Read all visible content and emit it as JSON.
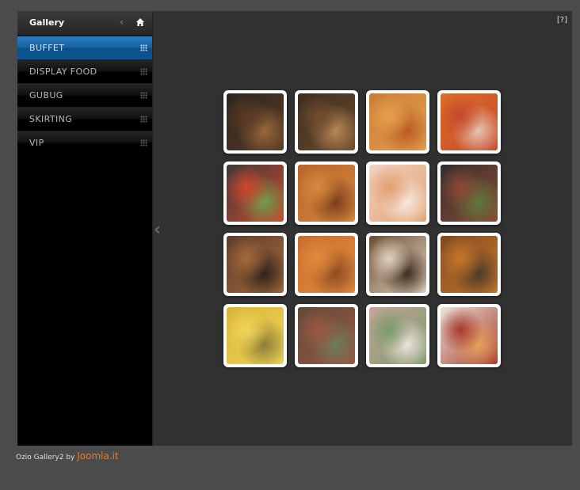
{
  "sidebar": {
    "title": "Gallery",
    "items": [
      {
        "label": "BUFFET",
        "active": true
      },
      {
        "label": "DISPLAY FOOD",
        "active": false
      },
      {
        "label": "GUBUG",
        "active": false
      },
      {
        "label": "SKIRTING",
        "active": false
      },
      {
        "label": "VIP",
        "active": false
      }
    ]
  },
  "help_label": "[?]",
  "thumbnails": [
    {
      "name": "thumb-1",
      "colors": [
        "#2a2520",
        "#5a3a24",
        "#9b6a3c"
      ]
    },
    {
      "name": "thumb-2",
      "colors": [
        "#3a2b20",
        "#6f4b2c",
        "#b98a5a"
      ]
    },
    {
      "name": "thumb-3",
      "colors": [
        "#c87b35",
        "#e6a14e",
        "#b85a22"
      ]
    },
    {
      "name": "thumb-4",
      "colors": [
        "#d96f2a",
        "#c6492a",
        "#e7c7b8"
      ]
    },
    {
      "name": "thumb-5",
      "colors": [
        "#3a3a3a",
        "#d0462e",
        "#6f9f4a"
      ]
    },
    {
      "name": "thumb-6",
      "colors": [
        "#b9622b",
        "#d48a3e",
        "#7a3d1c"
      ]
    },
    {
      "name": "thumb-7",
      "colors": [
        "#f1d4c6",
        "#e3a06f",
        "#f6e9e2"
      ]
    },
    {
      "name": "thumb-8",
      "colors": [
        "#2e2e2e",
        "#8e4a34",
        "#5f7a3a"
      ]
    },
    {
      "name": "thumb-9",
      "colors": [
        "#5d3b2c",
        "#a46a3a",
        "#2e211b"
      ]
    },
    {
      "name": "thumb-10",
      "colors": [
        "#c76d2e",
        "#e28a3c",
        "#8b4b22"
      ]
    },
    {
      "name": "thumb-11",
      "colors": [
        "#6a4c33",
        "#e1d3bf",
        "#3e2a1f"
      ]
    },
    {
      "name": "thumb-12",
      "colors": [
        "#7d4a24",
        "#c7762a",
        "#4a3a2a"
      ]
    },
    {
      "name": "thumb-13",
      "colors": [
        "#d8b437",
        "#f0d55a",
        "#8a7a36"
      ]
    },
    {
      "name": "thumb-14",
      "colors": [
        "#5f4a3c",
        "#9b5740",
        "#6d7d5a"
      ]
    },
    {
      "name": "thumb-15",
      "colors": [
        "#c6a59a",
        "#7a9a6a",
        "#efe5e0"
      ]
    },
    {
      "name": "thumb-16",
      "colors": [
        "#eae4dc",
        "#a7392b",
        "#e7a15a"
      ]
    }
  ],
  "footer": {
    "text": "Ozio Gallery2 by",
    "link": "Joomla.it"
  }
}
